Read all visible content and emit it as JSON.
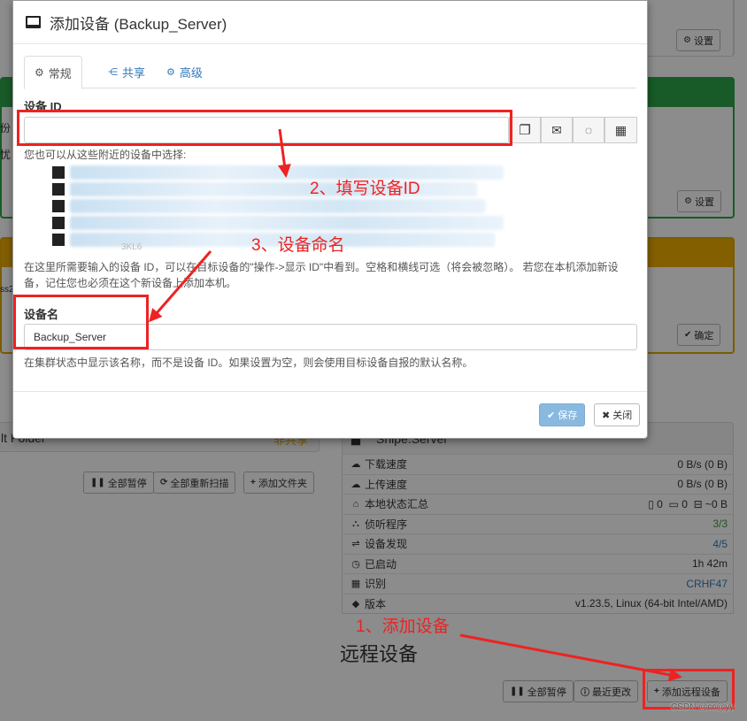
{
  "background": {
    "settings_label": "设置",
    "confirm_label": "确定",
    "snippet_left_1": "份",
    "snippet_left_2": "忧",
    "snippet_left_3": "ss23",
    "folder_name": "lt Folder",
    "folder_status": "非共享",
    "folder_buttons": {
      "pause_all": "全部暂停",
      "rescan_all": "全部重新扫描",
      "add_folder": "添加文件夹"
    },
    "device_panel": {
      "name": "Shipe.Server",
      "rows": [
        {
          "icon": "cloud-download-icon",
          "label": "下载速度",
          "value": "0 B/s (0 B)"
        },
        {
          "icon": "cloud-upload-icon",
          "label": "上传速度",
          "value": "0 B/s (0 B)"
        },
        {
          "icon": "home-icon",
          "label": "本地状态汇总",
          "files": "0",
          "dirs": "0",
          "size": "~0 B"
        },
        {
          "icon": "sitemap-icon",
          "label": "侦听程序",
          "value": "3/3",
          "value_color": "#3c9a3c"
        },
        {
          "icon": "signpost-icon",
          "label": "设备发现",
          "value": "4/5",
          "value_color": "#337ab7"
        },
        {
          "icon": "clock-icon",
          "label": "已启动",
          "value": "1h 42m"
        },
        {
          "icon": "qrcode-icon",
          "label": "识别",
          "value": "CRHF47",
          "value_color": "#337ab7"
        },
        {
          "icon": "tag-icon",
          "label": "版本",
          "value": "v1.23.5, Linux (64-bit Intel/AMD)"
        }
      ]
    },
    "remote_devices_title": "远程设备",
    "remote_buttons": {
      "pause_all": "全部暂停",
      "recent_changes": "最近更改",
      "add_remote": "添加远程设备"
    },
    "panel_colors": {
      "green": "#2ca44a",
      "yellow": "#e0a800"
    }
  },
  "modal": {
    "title": "添加设备 (Backup_Server)",
    "tabs": [
      {
        "label": "常规",
        "icon": "gear-icon",
        "active": true
      },
      {
        "label": "共享",
        "icon": "share-icon",
        "active": false
      },
      {
        "label": "高级",
        "icon": "cogs-icon",
        "active": false
      }
    ],
    "device_id_label": "设备 ID",
    "device_id_value": "",
    "nearby_text": "您也可以从这些附近的设备中选择:",
    "nearby_tail": "3KL6",
    "device_id_help": "在这里所需要输入的设备 ID，可以在目标设备的\"操作->显示 ID\"中看到。空格和横线可选（将会被忽略）。 若您在本机添加新设备，记住您也必须在这个新设备上添加本机。",
    "device_name_label": "设备名",
    "device_name_value": "Backup_Server",
    "device_name_help": "在集群状态中显示该名称，而不是设备 ID。如果设置为空，则会使用目标设备自报的默认名称。",
    "save_label": "保存",
    "close_label": "关闭"
  },
  "annotations": {
    "step1": "1、添加设备",
    "step2": "2、填写设备ID",
    "step3": "3、设备命名"
  },
  "watermark": "CSDN @cc@yy"
}
